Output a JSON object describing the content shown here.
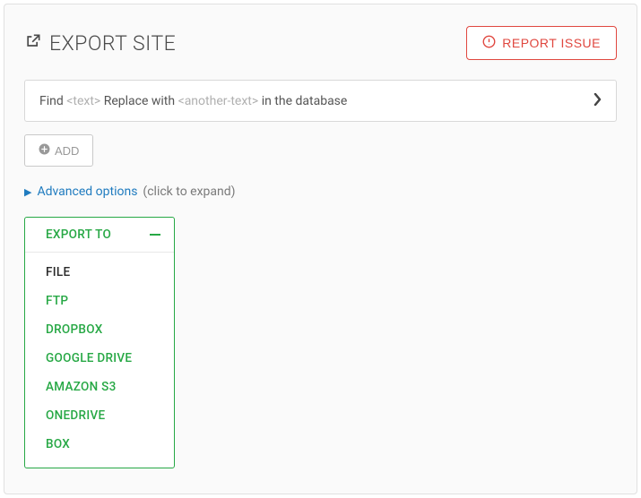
{
  "header": {
    "title": "EXPORT SITE",
    "report_button": "REPORT ISSUE"
  },
  "find_replace": {
    "find_label": "Find",
    "placeholder1": "<text>",
    "replace_label": "Replace with",
    "placeholder2": "<another-text>",
    "suffix": "in the database"
  },
  "add_button": "ADD",
  "advanced": {
    "label": "Advanced options",
    "hint": "(click to expand)"
  },
  "export_dropdown": {
    "header": "EXPORT TO",
    "selected": "FILE",
    "items": [
      "FILE",
      "FTP",
      "DROPBOX",
      "GOOGLE DRIVE",
      "AMAZON S3",
      "ONEDRIVE",
      "BOX"
    ]
  }
}
